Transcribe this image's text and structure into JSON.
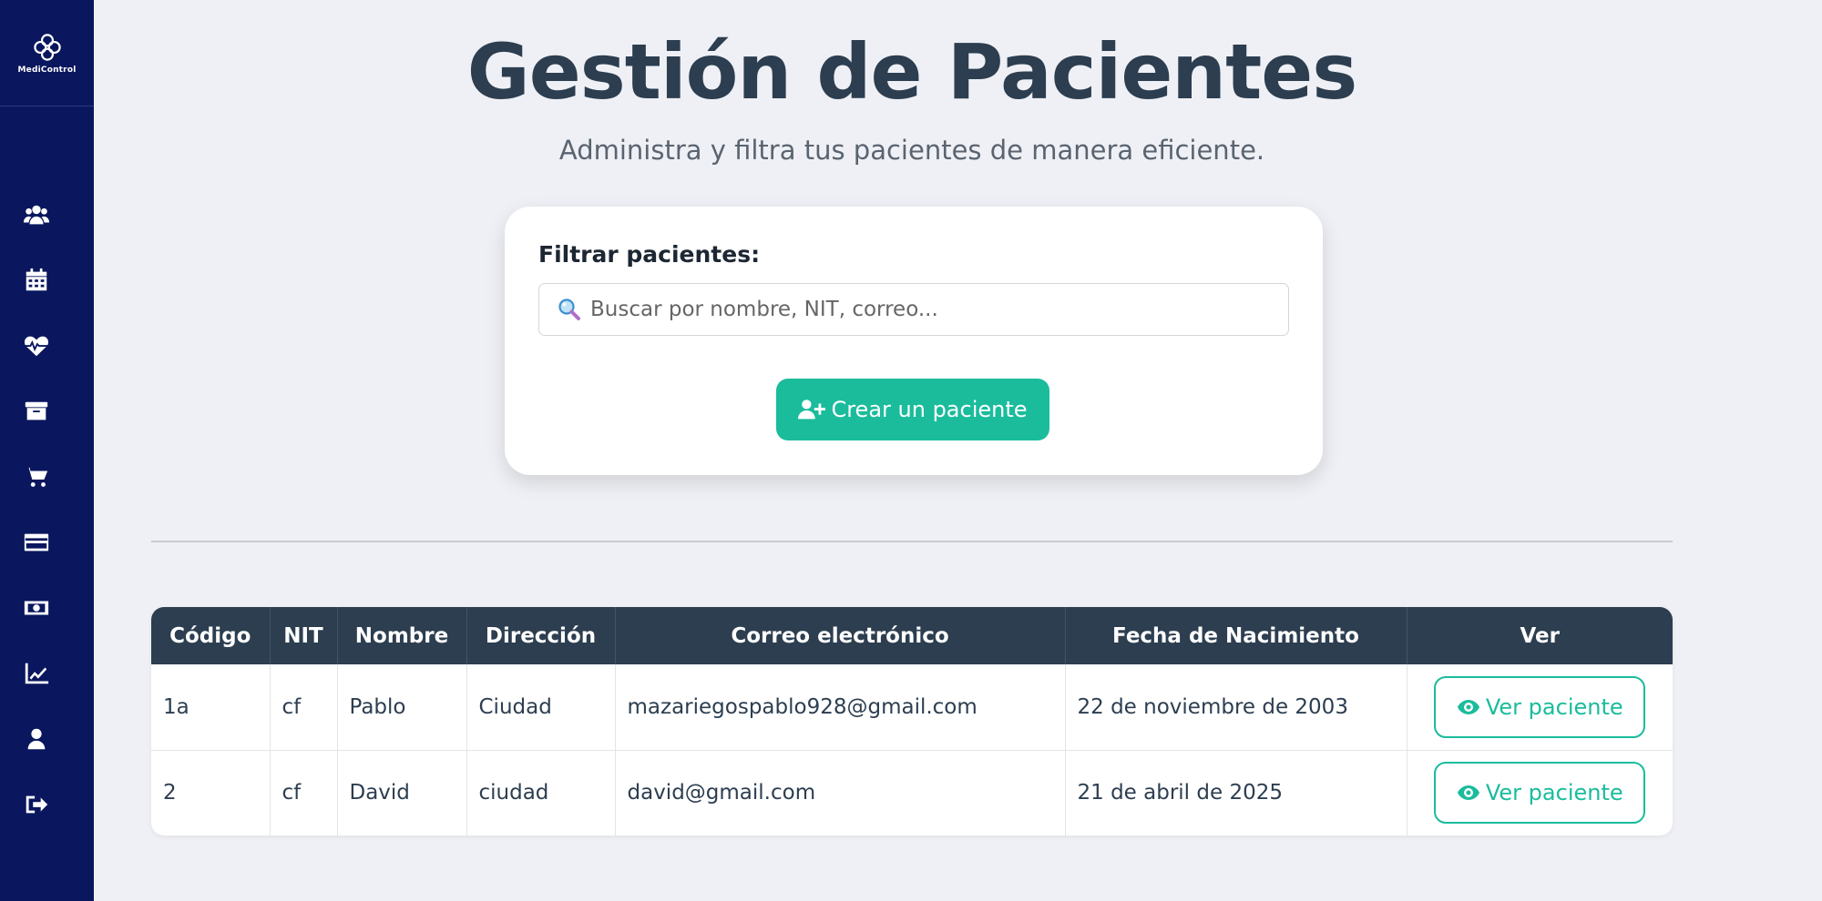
{
  "app": {
    "logo_text": "MediControl"
  },
  "sidebar": {
    "items": [
      {
        "icon": "users-icon"
      },
      {
        "icon": "calendar-icon"
      },
      {
        "icon": "heartbeat-icon"
      },
      {
        "icon": "archive-icon"
      },
      {
        "icon": "cart-icon"
      },
      {
        "icon": "credit-card-icon"
      },
      {
        "icon": "money-icon"
      },
      {
        "icon": "chart-line-icon"
      },
      {
        "icon": "user-icon"
      },
      {
        "icon": "logout-icon"
      }
    ]
  },
  "header": {
    "title": "Gestión de Pacientes",
    "subtitle": "Administra y filtra tus pacientes de manera eficiente."
  },
  "filter": {
    "label": "Filtrar pacientes:",
    "search_placeholder": "Buscar por nombre, NIT, correo...",
    "search_value": "",
    "create_label": "Crear un paciente"
  },
  "table": {
    "columns": [
      "Código",
      "NIT",
      "Nombre",
      "Dirección",
      "Correo electrónico",
      "Fecha de Nacimiento",
      "Ver"
    ],
    "rows": [
      {
        "codigo": "1a",
        "nit": "cf",
        "nombre": "Pablo",
        "direccion": "Ciudad",
        "correo": "mazariegospablo928@gmail.com",
        "fecha": "22 de noviembre de 2003",
        "action": "Ver paciente"
      },
      {
        "codigo": "2",
        "nit": "cf",
        "nombre": "David",
        "direccion": "ciudad",
        "correo": "david@gmail.com",
        "fecha": "21 de abril de 2025",
        "action": "Ver paciente"
      }
    ]
  },
  "colors": {
    "sidebar": "#0a175e",
    "accent": "#1abc9c",
    "header_dark": "#2c3e50",
    "background": "#eff0f5"
  }
}
